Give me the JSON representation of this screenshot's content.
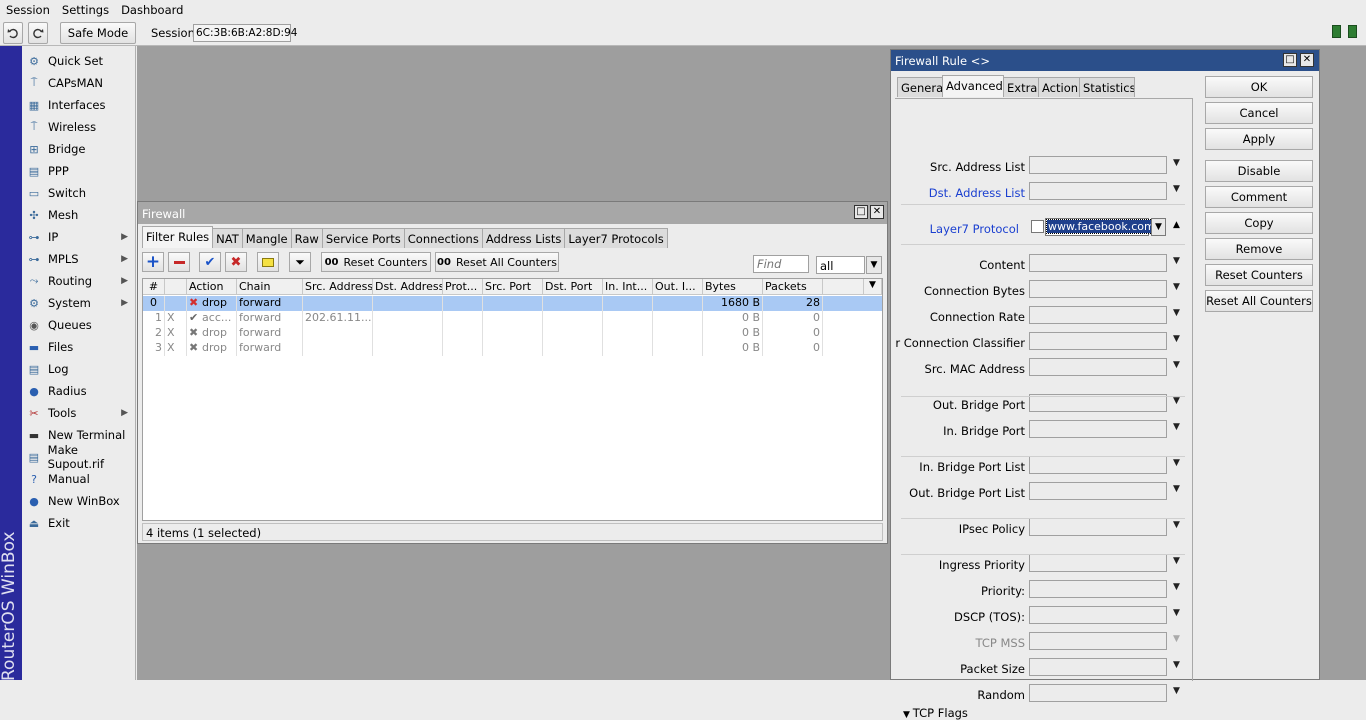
{
  "menubar": {
    "items": [
      "Session",
      "Settings",
      "Dashboard"
    ]
  },
  "toolbar": {
    "undo_icon": "undo-icon",
    "redo_icon": "redo-icon",
    "safe_mode": "Safe Mode",
    "session_label": "Session",
    "session_value": "6C:3B:6B:A2:8D:94"
  },
  "brand": {
    "vertical_text": "RouterOS WinBox",
    "band_color": "#2a2a9c"
  },
  "sidebar": {
    "items": [
      {
        "label": "Quick Set",
        "icon": "quickset-icon",
        "sub": false
      },
      {
        "label": "CAPsMAN",
        "icon": "capsman-icon",
        "sub": false
      },
      {
        "label": "Interfaces",
        "icon": "interfaces-icon",
        "sub": false
      },
      {
        "label": "Wireless",
        "icon": "wireless-icon",
        "sub": false
      },
      {
        "label": "Bridge",
        "icon": "bridge-icon",
        "sub": false
      },
      {
        "label": "PPP",
        "icon": "ppp-icon",
        "sub": false
      },
      {
        "label": "Switch",
        "icon": "switch-icon",
        "sub": false
      },
      {
        "label": "Mesh",
        "icon": "mesh-icon",
        "sub": false
      },
      {
        "label": "IP",
        "icon": "ip-icon",
        "sub": true
      },
      {
        "label": "MPLS",
        "icon": "mpls-icon",
        "sub": true
      },
      {
        "label": "Routing",
        "icon": "routing-icon",
        "sub": true
      },
      {
        "label": "System",
        "icon": "system-icon",
        "sub": true
      },
      {
        "label": "Queues",
        "icon": "queues-icon",
        "sub": false
      },
      {
        "label": "Files",
        "icon": "files-icon",
        "sub": false
      },
      {
        "label": "Log",
        "icon": "log-icon",
        "sub": false
      },
      {
        "label": "Radius",
        "icon": "radius-icon",
        "sub": false
      },
      {
        "label": "Tools",
        "icon": "tools-icon",
        "sub": true
      },
      {
        "label": "New Terminal",
        "icon": "terminal-icon",
        "sub": false
      },
      {
        "label": "Make Supout.rif",
        "icon": "supout-icon",
        "sub": false
      },
      {
        "label": "Manual",
        "icon": "manual-icon",
        "sub": false
      },
      {
        "label": "New WinBox",
        "icon": "winbox-icon",
        "sub": false
      },
      {
        "label": "Exit",
        "icon": "exit-icon",
        "sub": false
      }
    ]
  },
  "firewall": {
    "title": "Firewall",
    "tabs": [
      "Filter Rules",
      "NAT",
      "Mangle",
      "Raw",
      "Service Ports",
      "Connections",
      "Address Lists",
      "Layer7 Protocols"
    ],
    "reset_counters": "Reset Counters",
    "reset_all_counters": "Reset All Counters",
    "counter_prefix": "00",
    "find_placeholder": "Find",
    "filter_value": "all",
    "columns": [
      "#",
      "",
      "Action",
      "Chain",
      "Src. Address",
      "Dst. Address",
      "Prot...",
      "Src. Port",
      "Dst. Port",
      "In. Int...",
      "Out. I...",
      "Bytes",
      "Packets"
    ],
    "rows": [
      {
        "num": "0",
        "flag": "",
        "action": "drop",
        "chain": "forward",
        "src": "",
        "bytes": "1680 B",
        "packets": "28",
        "selected": true,
        "disabled": false
      },
      {
        "num": "1",
        "flag": "X",
        "action": "acc...",
        "chain": "forward",
        "src": "202.61.11...",
        "bytes": "0 B",
        "packets": "0",
        "selected": false,
        "disabled": true
      },
      {
        "num": "2",
        "flag": "X",
        "action": "drop",
        "chain": "forward",
        "src": "",
        "bytes": "0 B",
        "packets": "0",
        "selected": false,
        "disabled": true
      },
      {
        "num": "3",
        "flag": "X",
        "action": "drop",
        "chain": "forward",
        "src": "",
        "bytes": "0 B",
        "packets": "0",
        "selected": false,
        "disabled": true
      }
    ],
    "status": "4 items (1 selected)"
  },
  "rule": {
    "title": "Firewall Rule <>",
    "tabs": [
      "General",
      "Advanced",
      "Extra",
      "Action",
      "Statistics"
    ],
    "fields": {
      "src_address_list": "Src. Address List",
      "dst_address_list": "Dst. Address List",
      "layer7_protocol": "Layer7 Protocol",
      "layer7_value": "www.facebook.com",
      "content": "Content",
      "connection_bytes": "Connection Bytes",
      "connection_rate": "Connection Rate",
      "per_connection_classifier": "Per Connection Classifier",
      "src_mac_address": "Src. MAC Address",
      "out_bridge_port": "Out. Bridge Port",
      "in_bridge_port": "In. Bridge Port",
      "in_bridge_port_list": "In. Bridge Port List",
      "out_bridge_port_list": "Out. Bridge Port List",
      "ipsec_policy": "IPsec Policy",
      "ingress_priority": "Ingress Priority",
      "priority": "Priority:",
      "dscp": "DSCP (TOS):",
      "tcp_mss": "TCP MSS",
      "packet_size": "Packet Size",
      "random": "Random",
      "tcp_flags": "TCP Flags"
    },
    "buttons": [
      "OK",
      "Cancel",
      "Apply",
      "Disable",
      "Comment",
      "Copy",
      "Remove",
      "Reset Counters",
      "Reset All Counters"
    ]
  }
}
